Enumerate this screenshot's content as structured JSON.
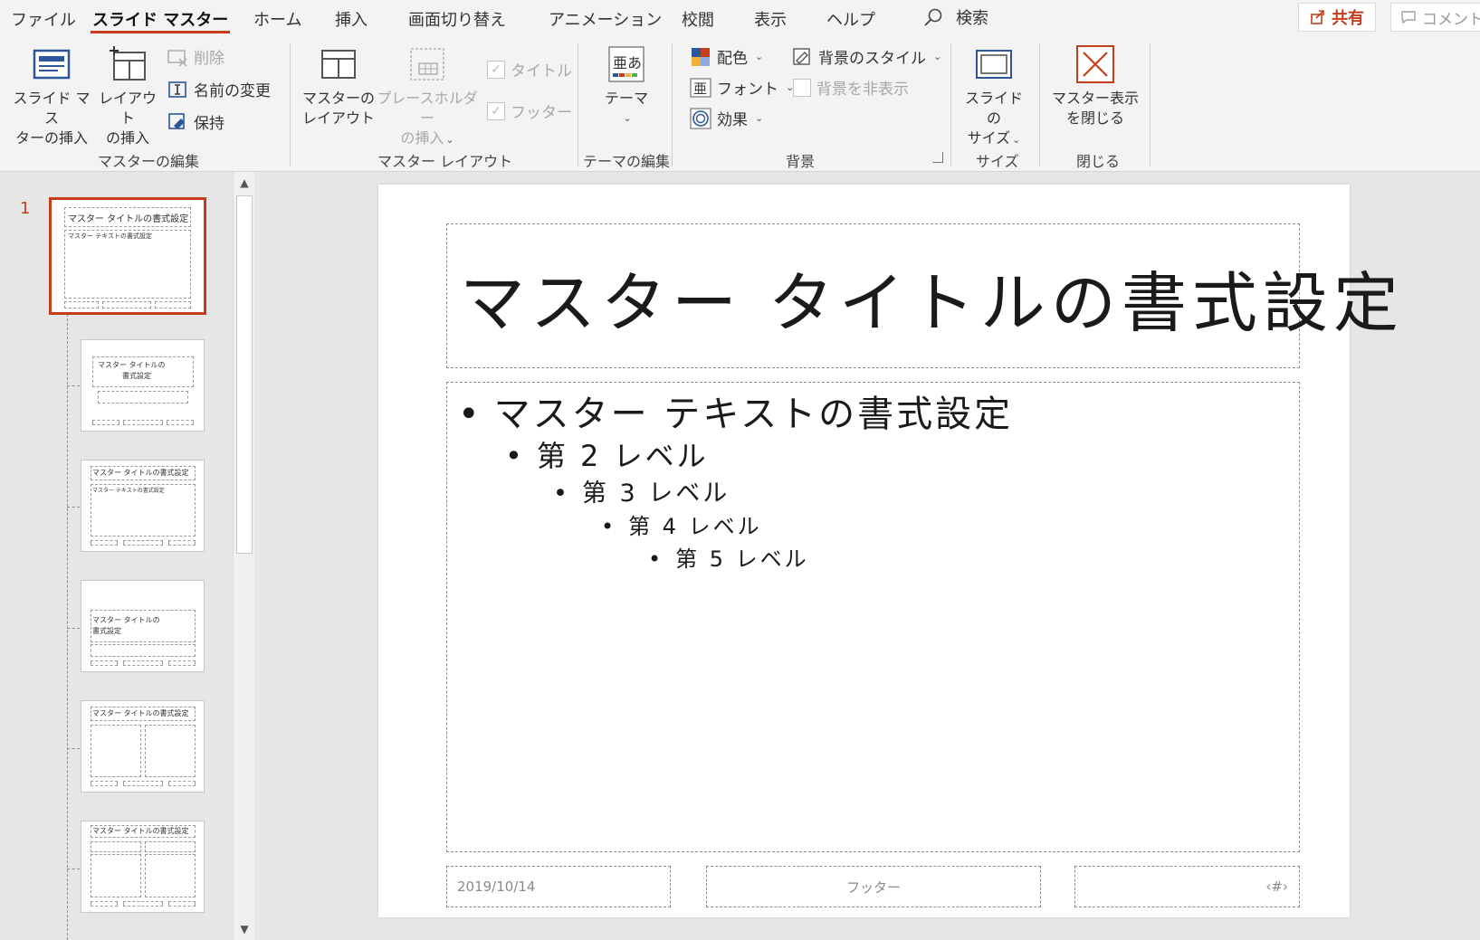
{
  "menu": {
    "tabs": [
      "ファイル",
      "スライド マスター",
      "ホーム",
      "挿入",
      "画面切り替え",
      "アニメーション",
      "校閲",
      "表示",
      "ヘルプ"
    ],
    "active_tab": "スライド マスター",
    "search_label": "検索",
    "share_label": "共有",
    "comment_label": "コメント"
  },
  "ribbon": {
    "groups": {
      "master_edit": "マスターの編集",
      "master_layout": "マスター レイアウト",
      "theme_edit": "テーマの編集",
      "background": "背景",
      "size": "サイズ",
      "close": "閉じる"
    },
    "buttons": {
      "insert_master_1": "スライド マス",
      "insert_master_2": "ターの挿入",
      "insert_layout_1": "レイアウト",
      "insert_layout_2": "の挿入",
      "delete": "削除",
      "rename": "名前の変更",
      "preserve": "保持",
      "master_layout_1": "マスターの",
      "master_layout_2": "レイアウト",
      "placeholder_1": "プレースホルダー",
      "placeholder_2": "の挿入",
      "title_check": "タイトル",
      "footer_check": "フッター",
      "theme": "テーマ",
      "colors": "配色",
      "fonts": "フォント",
      "effects": "効果",
      "bg_styles": "背景のスタイル",
      "hide_bg": "背景を非表示",
      "slide_size_1": "スライドの",
      "slide_size_2": "サイズ",
      "close_master_1": "マスター表示",
      "close_master_2": "を閉じる"
    }
  },
  "slide_pane": {
    "master_number": "1",
    "thumb_title": "マスター タイトルの書式設定",
    "thumb_body": "マスター テキストの書式設定",
    "thumb_title_split_1": "マスター タイトルの",
    "thumb_title_split_2": "書式設定"
  },
  "slide": {
    "title": "マスター タイトルの書式設定",
    "levels": [
      {
        "bullet": "•",
        "text": "マスター テキストの書式設定"
      },
      {
        "bullet": "•",
        "text": "第 2 レベル"
      },
      {
        "bullet": "•",
        "text": "第 3 レベル"
      },
      {
        "bullet": "•",
        "text": "第 4 レベル"
      },
      {
        "bullet": "•",
        "text": "第 5 レベル"
      }
    ],
    "date": "2019/10/14",
    "footer": "フッター",
    "slide_number": "‹#›"
  },
  "colors": {
    "accent": "#c43e1c",
    "ribbon_bg": "#f3f3f3",
    "pane_bg": "#e6e6e6"
  }
}
